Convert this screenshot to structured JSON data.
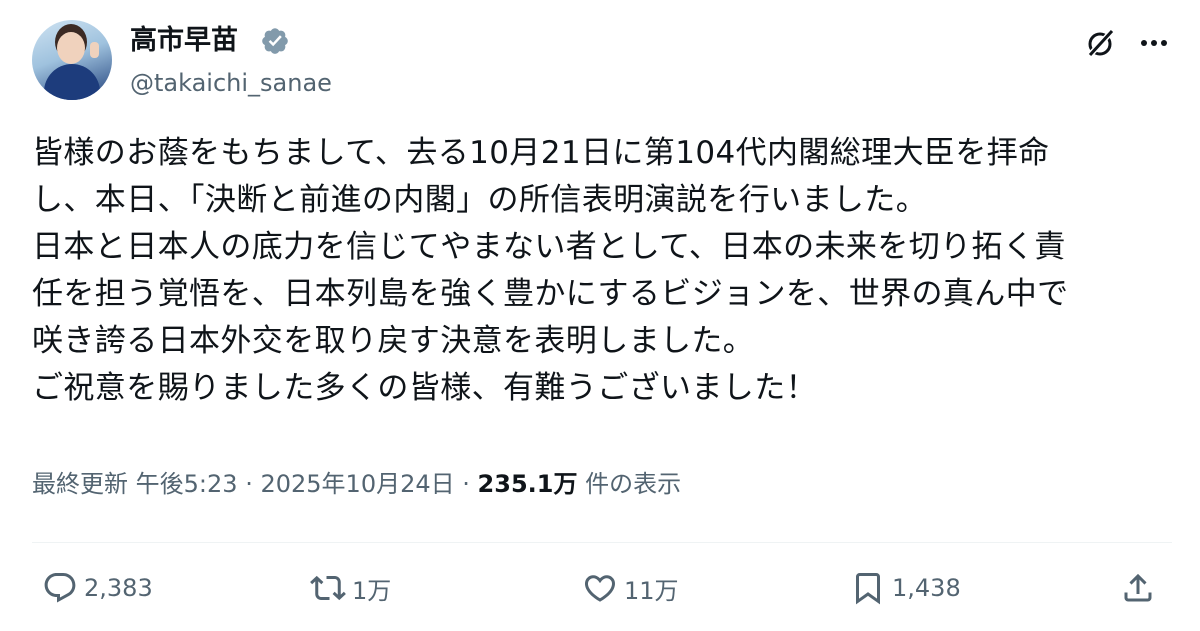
{
  "author": {
    "display_name": "高市早苗",
    "handle": "@takaichi_sanae"
  },
  "tweet": {
    "text": "皆様のお蔭をもちまして、去る10月21日に第104代内閣総理大臣を拝命\nし、本日、「決断と前進の内閣」の所信表明演説を行いました。\n日本と日本人の底力を信じてやまない者として、日本の未来を切り拓く責\n任を担う覚悟を、日本列島を強く豊かにするビジョンを、世界の真ん中で\n咲き誇る日本外交を取り戻す決意を表明しました。\nご祝意を賜りました多くの皆様、有難うございました！"
  },
  "meta": {
    "updated_label": "最終更新",
    "time": "午後5:23",
    "sep1": "·",
    "date": "2025年10月24日",
    "sep2": "·",
    "views": "235.1万",
    "views_label": "件の表示"
  },
  "actions": {
    "replies": "2,383",
    "reposts": "1万",
    "likes": "11万",
    "bookmarks": "1,438"
  },
  "icons": [
    "verified-badge-icon",
    "grok-icon",
    "more-icon",
    "reply-icon",
    "repost-icon",
    "like-icon",
    "bookmark-icon",
    "share-icon"
  ],
  "colors": {
    "text": "#0f1419",
    "secondary": "#536471",
    "divider": "#eff3f4",
    "verified": "#829aab"
  }
}
